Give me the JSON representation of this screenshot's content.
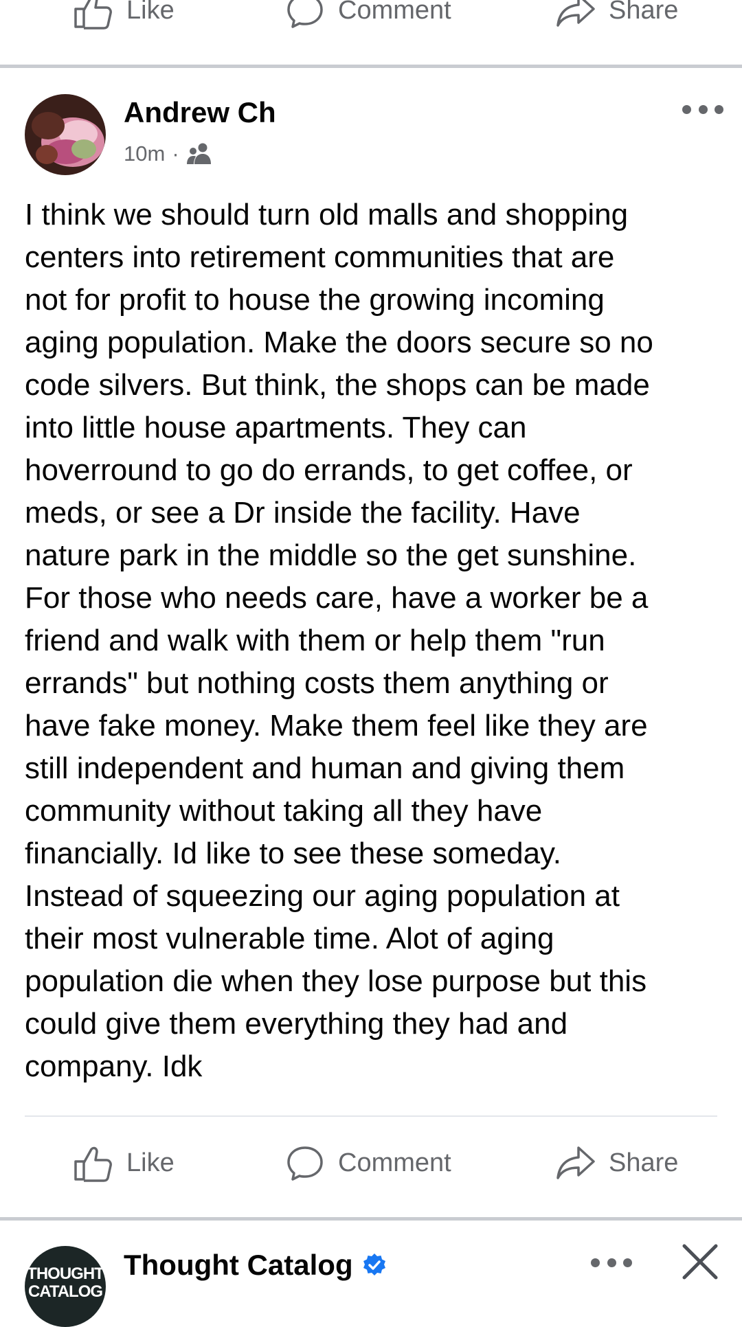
{
  "top_actions": {
    "like": "Like",
    "comment": "Comment",
    "share": "Share"
  },
  "post": {
    "author": "Andrew Ch",
    "time": "10m",
    "separator": "·",
    "audience_icon": "friends-icon",
    "more_icon": "more-options-icon",
    "text": "I think we should turn old malls and shopping\ncenters into retirement communities that are\nnot for profit to house the growing incoming\naging population. Make the doors secure so no\ncode silvers. But think, the shops can be made\ninto little house apartments. They can\nhoverround to go do errands, to get coffee, or\nmeds, or see a Dr inside the facility. Have\nnature park in the middle so the get sunshine.\nFor those who needs care, have a worker be a\nfriend and walk with them or help them \"run\nerrands\" but nothing costs them anything or\nhave fake money. Make them feel like they are\nstill independent and human and giving them\ncommunity without taking all they have\nfinancially. Id like to see these someday.\nInstead of squeezing our aging population at\ntheir most vulnerable time. Alot of aging\npopulation die when they lose purpose but this\ncould give them everything they had and\ncompany. Idk",
    "actions": {
      "like": "Like",
      "comment": "Comment",
      "share": "Share"
    }
  },
  "next_post": {
    "author": "Thought Catalog",
    "verified_icon": "verified-badge-icon",
    "avatar_text_line1": "THOUGHT",
    "avatar_text_line2": "CATALOG",
    "close_icon": "close-icon"
  },
  "colors": {
    "text": "#050505",
    "secondary": "#65676b",
    "verified": "#1877f2",
    "divider": "#c9ccd1"
  }
}
